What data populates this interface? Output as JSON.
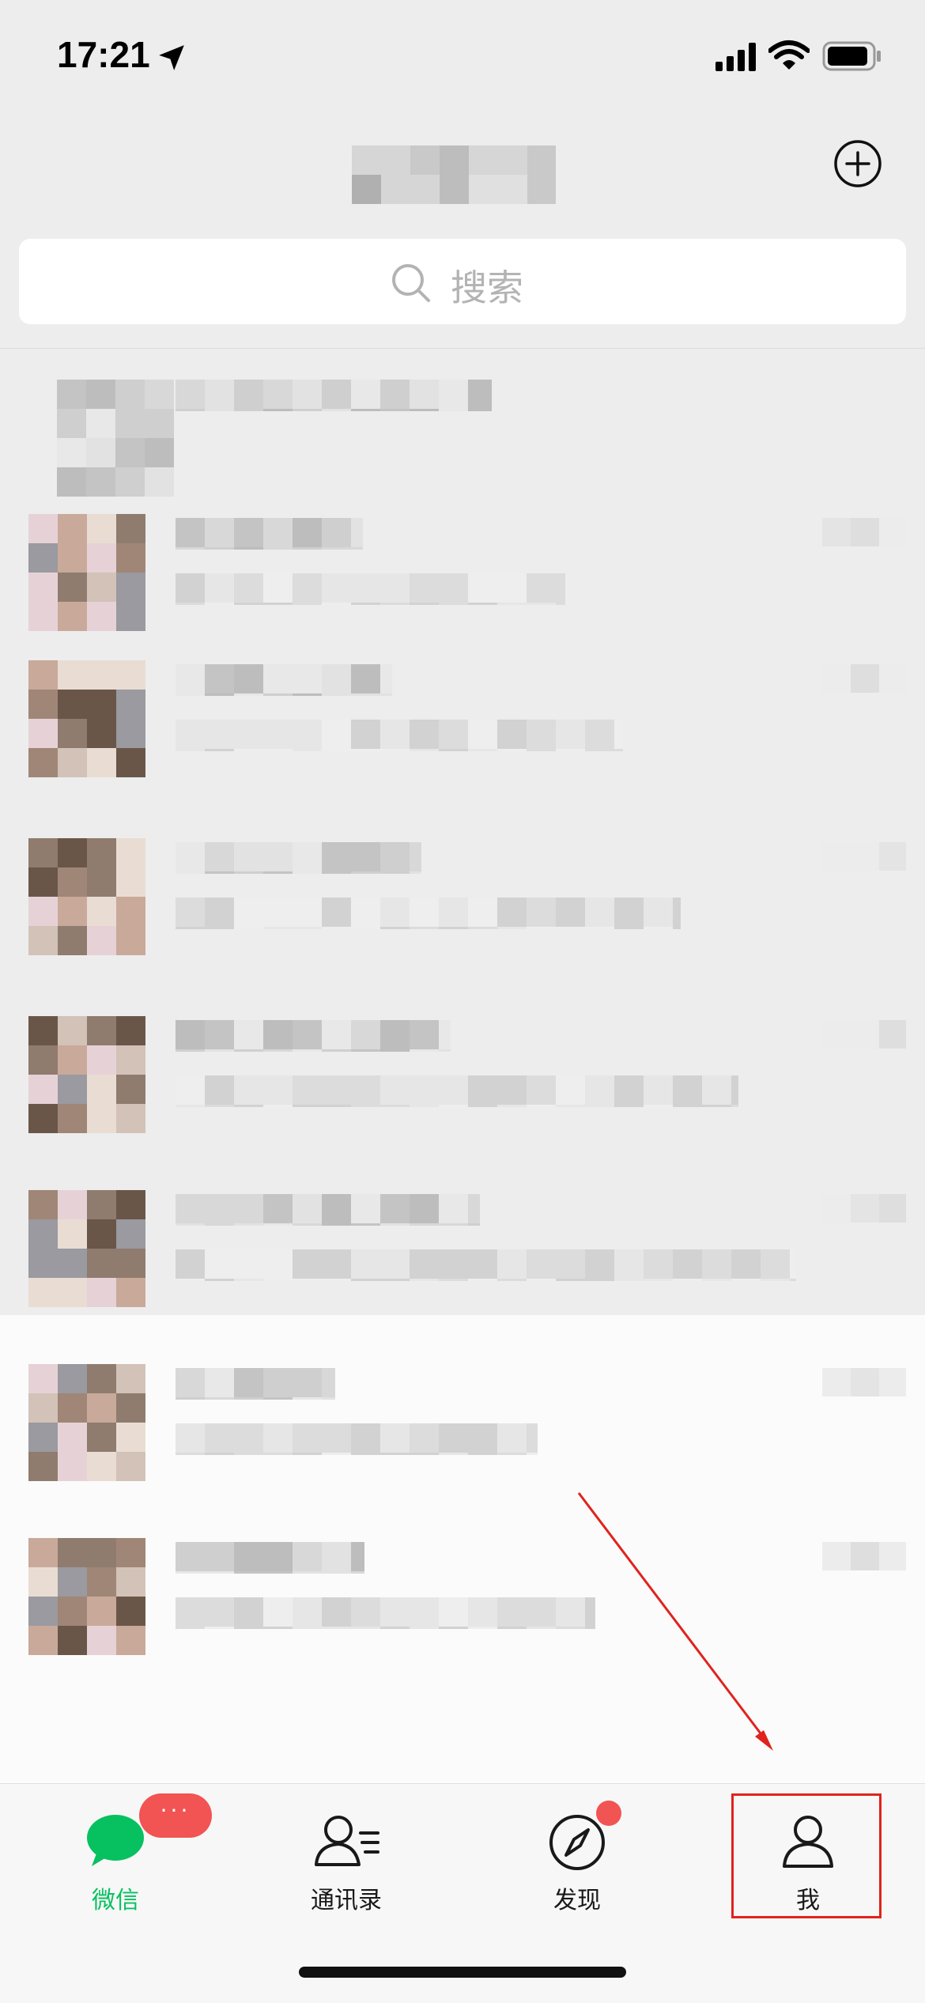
{
  "status_bar": {
    "time": "17:21",
    "icons": [
      "location-arrow-icon",
      "signal-icon",
      "wifi-icon",
      "battery-icon"
    ]
  },
  "header": {
    "add_icon": "plus-circle-icon"
  },
  "search": {
    "label": "搜索",
    "icon": "search-icon"
  },
  "tabs": [
    {
      "label": "微信",
      "icon": "chat-bubble-icon",
      "active": true
    },
    {
      "label": "通讯录",
      "icon": "contacts-icon",
      "active": false
    },
    {
      "label": "发现",
      "icon": "compass-icon",
      "active": false
    },
    {
      "label": "我",
      "icon": "person-icon",
      "active": false
    }
  ],
  "badges": {
    "chats_more": "···"
  },
  "colors": {
    "active_tab": "#07c160",
    "badge": "#f25353",
    "annotation": "#e0231c",
    "background": "#ededed"
  }
}
